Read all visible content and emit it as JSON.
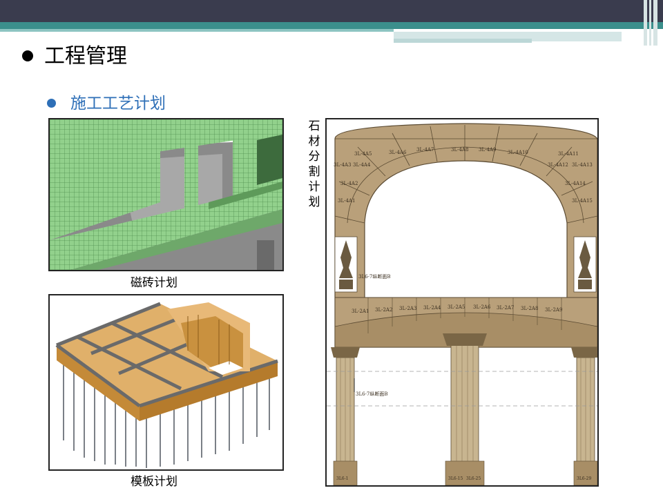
{
  "header": {
    "title": "工程管理",
    "subtitle": "施工工艺计划"
  },
  "images": {
    "tile": {
      "caption": "磁砖计划"
    },
    "formwork": {
      "caption": "模板计划"
    },
    "stone": {
      "caption_chars": [
        "石",
        "材",
        "分",
        "割",
        "计",
        "划"
      ],
      "section_label_1": "3L6-7纵断面B",
      "section_label_2": "3L6-7纵断面B",
      "arch_blocks": [
        "3L-4A1",
        "3L-4A2",
        "3L-4A3",
        "3L-4A4",
        "3L-4A5",
        "3L-4A6",
        "3L-4A7",
        "3L-4A8",
        "3L-4A9",
        "3L-4A10",
        "3L-4A11",
        "3L-4A12",
        "3L-4A13",
        "3L-4A14",
        "3L-4A15"
      ],
      "beam_blocks": [
        "3L-2A1",
        "3L-2A2",
        "3L-2A3",
        "3L-2A4",
        "3L-2A5",
        "3L-2A6",
        "3L-2A7",
        "3L-2A8",
        "3L-2A9"
      ],
      "column_labels": [
        "3L6-1",
        "3L6-15",
        "3L6-25",
        "3L6-29"
      ]
    }
  },
  "colors": {
    "accent": "#2e6fb7",
    "banner": "#3a3c4e",
    "teal": "#3b8f8c",
    "stone": "#b8a07c",
    "tile_green": "#8fd08a",
    "formwork_wood": "#d8a860"
  }
}
